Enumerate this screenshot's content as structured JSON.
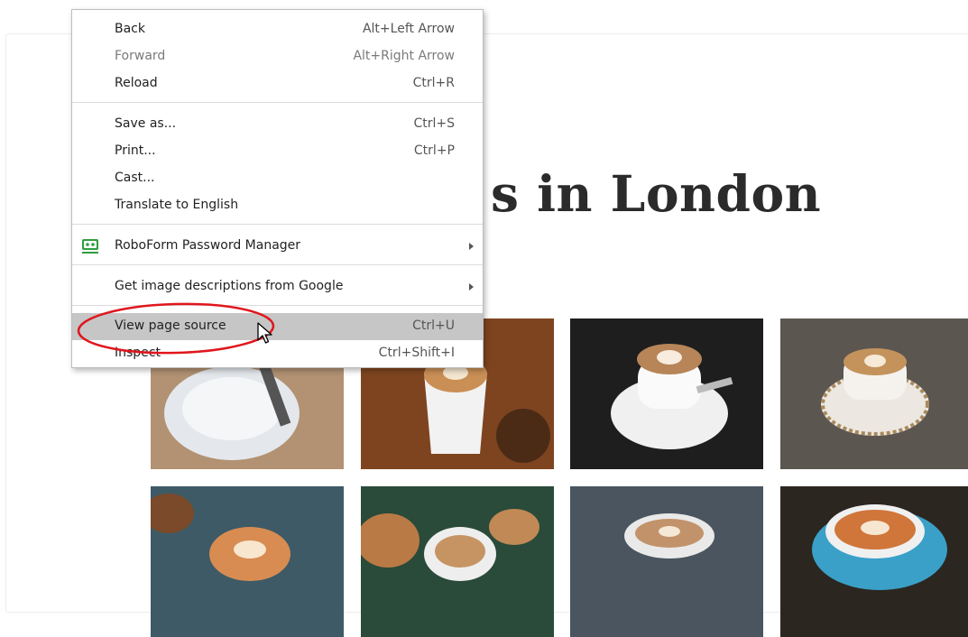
{
  "page": {
    "heading": "s in London"
  },
  "context_menu": {
    "items": [
      {
        "label": "Back",
        "shortcut": "Alt+Left Arrow"
      },
      {
        "label": "Forward",
        "shortcut": "Alt+Right Arrow"
      },
      {
        "label": "Reload",
        "shortcut": "Ctrl+R"
      },
      {
        "label": "Save as...",
        "shortcut": "Ctrl+S"
      },
      {
        "label": "Print...",
        "shortcut": "Ctrl+P"
      },
      {
        "label": "Cast..."
      },
      {
        "label": "Translate to English"
      },
      {
        "label": "RoboForm Password Manager",
        "icon": "roboform-icon"
      },
      {
        "label": "Get image descriptions from Google"
      },
      {
        "label": "View page source",
        "shortcut": "Ctrl+U"
      },
      {
        "label": "Inspect",
        "shortcut": "Ctrl+Shift+I"
      }
    ]
  },
  "colors": {
    "hover_bg": "#c6c6c6",
    "highlight_ellipse": "#e0161c",
    "roboform_green": "#2e9e3f"
  }
}
